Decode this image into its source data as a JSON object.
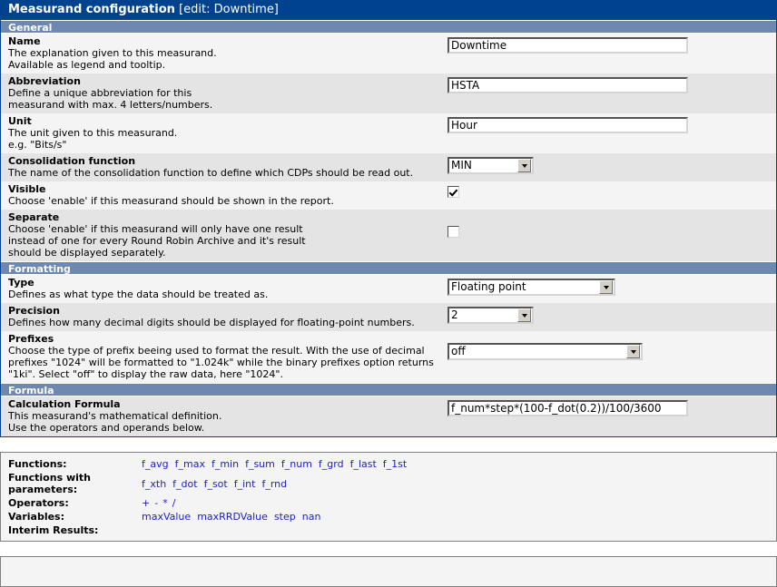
{
  "window": {
    "title_strong": "Measurand configuration",
    "title_light": "[edit: Downtime]"
  },
  "sections": {
    "general": "General",
    "formatting": "Formatting",
    "formula": "Formula"
  },
  "fields": {
    "name": {
      "label": "Name",
      "desc_line1": "The explanation given to this measurand.",
      "desc_line2": "Available as legend and tooltip.",
      "value": "Downtime"
    },
    "abbreviation": {
      "label": "Abbreviation",
      "desc_line1": "Define a unique abbreviation for this",
      "desc_line2": "measurand with max. 4 letters/numbers.",
      "value": "HSTA"
    },
    "unit": {
      "label": "Unit",
      "desc_line1": "The unit given to this measurand.",
      "desc_line2": "e.g. \"Bits/s\"",
      "value": "Hour"
    },
    "consolidation": {
      "label": "Consolidation function",
      "desc_line1": "The name of the consolidation function to define which CDPs should be read out.",
      "value": "MIN"
    },
    "visible": {
      "label": "Visible",
      "desc_line1": "Choose 'enable' if this measurand should be shown in the report.",
      "checked": true
    },
    "separate": {
      "label": "Separate",
      "desc_line1": "Choose 'enable' if this measurand will only have one result",
      "desc_line2": "instead of one for every Round Robin Archive and it's result",
      "desc_line3": "should be displayed separately.",
      "checked": false
    },
    "type": {
      "label": "Type",
      "desc_line1": "Defines as what type the data should be treated as.",
      "value": "Floating point"
    },
    "precision": {
      "label": "Precision",
      "desc_line1": "Defines how many decimal digits should be displayed for floating-point numbers.",
      "value": "2"
    },
    "prefixes": {
      "label": "Prefixes",
      "desc_line1": "Choose the type of prefix beeing used to format the result. With the use of decimal",
      "desc_line2": "prefixes \"1024\" will be formatted to \"1.024k\" while the binary prefixes option returns",
      "desc_line3": "\"1ki\". Select \"off\" to display the raw data, here \"1024\".",
      "value": "off"
    },
    "calculation_formula": {
      "label": "Calculation Formula",
      "desc_line1": "This measurand's mathematical definition.",
      "desc_line2": "Use the operators and operands below.",
      "value": "f_num*step*(100-f_dot(0.2))/100/3600"
    }
  },
  "helper": {
    "functions_label": "Functions:",
    "functions": [
      "f_avg",
      "f_max",
      "f_min",
      "f_sum",
      "f_num",
      "f_grd",
      "f_last",
      "f_1st"
    ],
    "functions_params_label_line1": "Functions with",
    "functions_params_label_line2": "parameters:",
    "functions_params": [
      "f_xth",
      "f_dot",
      "f_sot",
      "f_int",
      "f_rnd"
    ],
    "operators_label": "Operators:",
    "operators": [
      "+",
      "-",
      "*",
      "/"
    ],
    "variables_label": "Variables:",
    "variables": [
      "maxValue",
      "maxRRDValue",
      "step",
      "nan"
    ],
    "interim_label": "Interim Results:",
    "interim": []
  },
  "colors": {
    "titlebar": "#00428e",
    "section": "#6f88b0",
    "row_light": "#f4f4f4",
    "row_dark": "#e4e4e4",
    "link": "#2020cc"
  }
}
